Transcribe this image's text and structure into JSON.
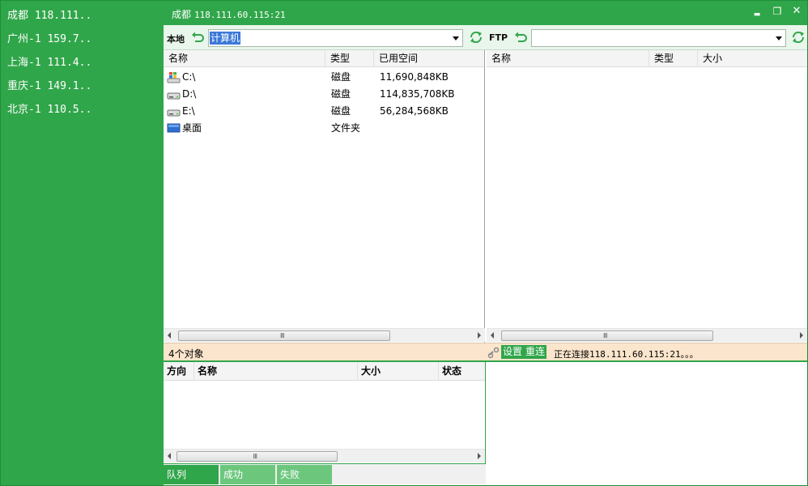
{
  "servers": [
    {
      "label": "成都 118.111.."
    },
    {
      "label": "广州-1 159.7.."
    },
    {
      "label": "上海-1 111.4.."
    },
    {
      "label": "重庆-1 149.1.."
    },
    {
      "label": "北京-1 110.5.."
    }
  ],
  "titlebar": {
    "city": "成都",
    "address": "118.111.60.115:21",
    "minimize_glyph": "▬",
    "restore_glyph": "❐",
    "close_glyph": "✕"
  },
  "local": {
    "label": "本地",
    "path_value": "计算机",
    "columns": [
      "名称",
      "类型",
      "已用空间"
    ],
    "rows": [
      {
        "name": "C:\\",
        "type": "磁盘",
        "used": "11,690,848KB",
        "icon": "windows-drive-icon"
      },
      {
        "name": "D:\\",
        "type": "磁盘",
        "used": "114,835,708KB",
        "icon": "drive-icon"
      },
      {
        "name": "E:\\",
        "type": "磁盘",
        "used": "56,284,568KB",
        "icon": "drive-icon"
      },
      {
        "name": "桌面",
        "type": "文件夹",
        "used": "",
        "icon": "desktop-icon"
      }
    ],
    "status": "4个对象",
    "scroll_grip": "Ⅲ"
  },
  "ftp": {
    "label": "FTP",
    "path_value": "",
    "columns": [
      "名称",
      "类型",
      "大小"
    ],
    "settings_label": "设置",
    "reconnect_label": "重连",
    "status": "正在连接118.111.60.115:21。。。",
    "scroll_grip": "Ⅲ"
  },
  "queue": {
    "columns": [
      "方向",
      "名称",
      "大小",
      "状态"
    ],
    "tabs": [
      "队列",
      "成功",
      "失败"
    ],
    "scroll_grip": "Ⅲ"
  },
  "colors": {
    "brand_green": "#30a64a",
    "status_bg": "#fbe5cc",
    "selection_blue": "#3a78d8"
  }
}
